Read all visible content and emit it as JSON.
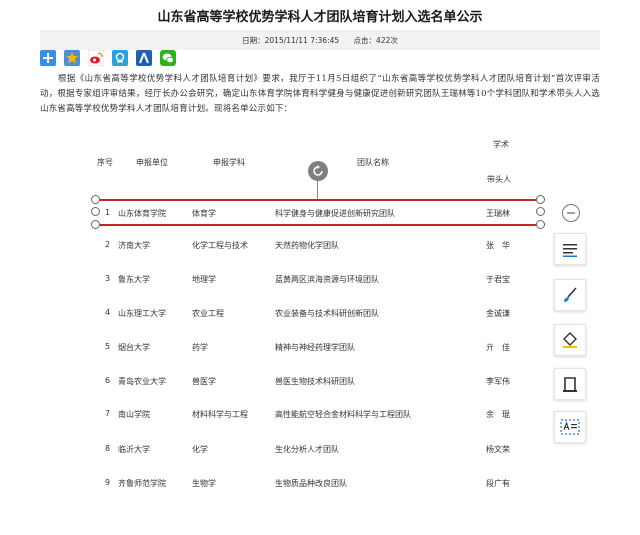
{
  "article": {
    "title": "山东省高等学校优势学科人才团队培育计划入选名单公示",
    "date_label": "日期：",
    "date_value": "2015/11/11 7:36:45",
    "views_label": "点击：",
    "views_value": "422次",
    "intro": "根据《山东省高等学校优势学科人才团队培育计划》要求，我厅于11月5日组织了“山东省高等学校优势学科人才团队培育计划”首次评审活动，根据专家组评审结果，经厅长办公会研究，确定山东体育学院体育科学健身与健康促进创新研究团队王瑞林等10个学科团队和学术带头人入选山东省高等学校优势学科人才团队培育计划。现将名单公示如下："
  },
  "share_icons": [
    {
      "name": "add-share-icon",
      "color": "#3a8ee6"
    },
    {
      "name": "qzone-icon",
      "color": "#f5b800"
    },
    {
      "name": "weibo-icon",
      "color": "#e6162d"
    },
    {
      "name": "tencent-weibo-icon",
      "color": "#2aa2d9"
    },
    {
      "name": "renren-icon",
      "color": "#1f5fb3"
    },
    {
      "name": "wechat-icon",
      "color": "#2ab41a"
    }
  ],
  "table": {
    "headers": {
      "index": "序号",
      "unit": "申报单位",
      "discipline": "申报学科",
      "team": "团队名称",
      "leader_line1": "学术",
      "leader_line2": "带头人"
    },
    "rows": [
      {
        "index": "1",
        "unit": "山东体育学院",
        "discipline": "体育学",
        "team": "科学健身与健康促进创新研究团队",
        "leader": "王瑞林"
      },
      {
        "index": "2",
        "unit": "济南大学",
        "discipline": "化学工程与技术",
        "team": "天然药物化学团队",
        "leader": "张　华"
      },
      {
        "index": "3",
        "unit": "鲁东大学",
        "discipline": "地理学",
        "team": "蓝黄两区滨海资源与环境团队",
        "leader": "于君宝"
      },
      {
        "index": "4",
        "unit": "山东理工大学",
        "discipline": "农业工程",
        "team": "农业装备与技术科研创新团队",
        "leader": "金诚谦"
      },
      {
        "index": "5",
        "unit": "烟台大学",
        "discipline": "药学",
        "team": "精神与神经药理学团队",
        "leader": "亓　佳"
      },
      {
        "index": "6",
        "unit": "青岛农业大学",
        "discipline": "兽医学",
        "team": "兽医生物技术科研团队",
        "leader": "李军伟"
      },
      {
        "index": "7",
        "unit": "南山学院",
        "discipline": "材料科学与工程",
        "team": "高性能航空轻合金材料科学与工程团队",
        "leader": "余　琨"
      },
      {
        "index": "8",
        "unit": "临沂大学",
        "discipline": "化学",
        "team": "生化分析人才团队",
        "leader": "杨文荣"
      },
      {
        "index": "9",
        "unit": "齐鲁师范学院",
        "discipline": "生物学",
        "team": "生物质品种改良团队",
        "leader": "段广有"
      }
    ]
  },
  "colors": {
    "selection": "#c1272d",
    "meta_bar": "#f2f2f2"
  },
  "toolbar": {
    "buttons": [
      {
        "name": "text-style-tool-button",
        "icon": "text-lines-icon"
      },
      {
        "name": "brush-tool-button",
        "icon": "brush-icon"
      },
      {
        "name": "fill-tool-button",
        "icon": "paint-bucket-icon"
      },
      {
        "name": "border-tool-button",
        "icon": "frame-icon"
      },
      {
        "name": "ocr-tool-button",
        "icon": "text-recognition-icon"
      }
    ]
  }
}
